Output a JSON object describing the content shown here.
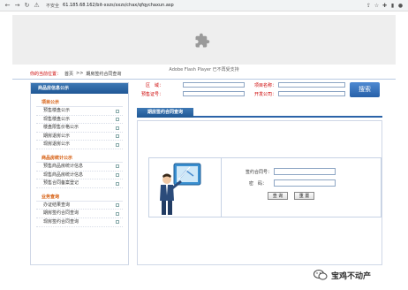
{
  "browser": {
    "insecure_label": "不安全",
    "url": "61.185.68.162/bit-xxzs/xxzs/chax/qfqychaxun.asp"
  },
  "flash": {
    "message": "Adobe Flash Player 已不再受支持"
  },
  "breadcrumb": {
    "current_label": "你的当前位置：",
    "home": "首页",
    "sep": ">>",
    "page": "期房签约合同查询"
  },
  "sidebar": {
    "header": "商品房信息公示",
    "sections": [
      {
        "title": "项目公示",
        "items": [
          "预售楼盘公示",
          "现售楼盘公示",
          "楼盘限售价格公示",
          "期房退房公示",
          "现房退房公示"
        ]
      },
      {
        "title": "商品房统计公示",
        "items": [
          "预售商品房统计信息",
          "现售商品房统计信息",
          "预售合同备案登记"
        ]
      },
      {
        "title": "业务查询",
        "items": [
          "办证结果查询",
          "期房签约合同查询",
          "现房签约合同查询"
        ]
      }
    ]
  },
  "search": {
    "region_label": "区　域：",
    "project_label": "项目名称：",
    "permit_label": "预售证号：",
    "developer_label": "开发公司：",
    "button_label": "搜索"
  },
  "main": {
    "tab_label": "期房签约合同查询",
    "contract_label": "签约合同号：",
    "password_label": "密　码：",
    "query_label": "查 询",
    "reset_label": "重 置"
  },
  "watermark": {
    "text": "宝鸡不动产"
  }
}
